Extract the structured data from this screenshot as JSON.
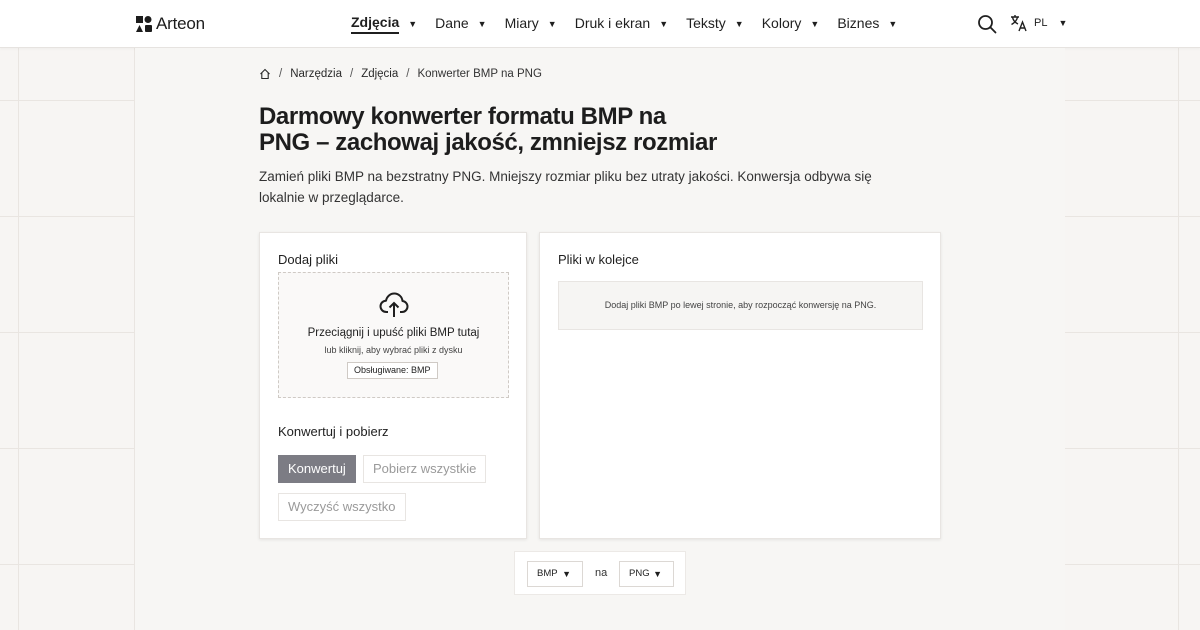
{
  "header": {
    "brand": "Arteon",
    "nav": [
      {
        "label": "Zdjęcia",
        "active": true
      },
      {
        "label": "Dane"
      },
      {
        "label": "Miary"
      },
      {
        "label": "Druk i ekran"
      },
      {
        "label": "Teksty"
      },
      {
        "label": "Kolory"
      },
      {
        "label": "Biznes"
      }
    ],
    "language": "PL",
    "icons": {
      "search": "search-icon",
      "language": "translate-icon",
      "caret": "caret-down-icon"
    }
  },
  "breadcrumb": {
    "home_icon": "home-icon",
    "items": [
      "Narzędzia",
      "Zdjęcia"
    ],
    "current": "Konwerter BMP na PNG"
  },
  "page": {
    "title": "Darmowy konwerter formatu BMP na PNG – zachowaj jakość, zmniejsz rozmiar",
    "description": "Zamień pliki BMP na bezstratny PNG. Mniejszy rozmiar pliku bez utraty jakości. Konwersja odbywa się lokalnie w przeglądarce."
  },
  "upload": {
    "heading": "Dodaj pliki",
    "icon": "cloud-upload-icon",
    "main_text": "Przeciągnij i upuść pliki BMP tutaj",
    "sub_text": "lub kliknij, aby wybrać pliki z dysku",
    "supported": "Obsługiwane: BMP"
  },
  "actions": {
    "heading": "Konwertuj i pobierz",
    "convert": "Konwertuj",
    "download_all": "Pobierz wszystkie",
    "clear_all": "Wyczyść wszystko"
  },
  "queue": {
    "heading": "Pliki w kolejce",
    "empty": "Dodaj pliki BMP po lewej stronie, aby rozpocząć konwersję na PNG."
  },
  "format_switch": {
    "from": "BMP",
    "connector": "na",
    "to": "PNG"
  },
  "colors": {
    "primary_button": "#7c7c84",
    "text": "#1f1f1f",
    "background": "#f7f5f3"
  }
}
